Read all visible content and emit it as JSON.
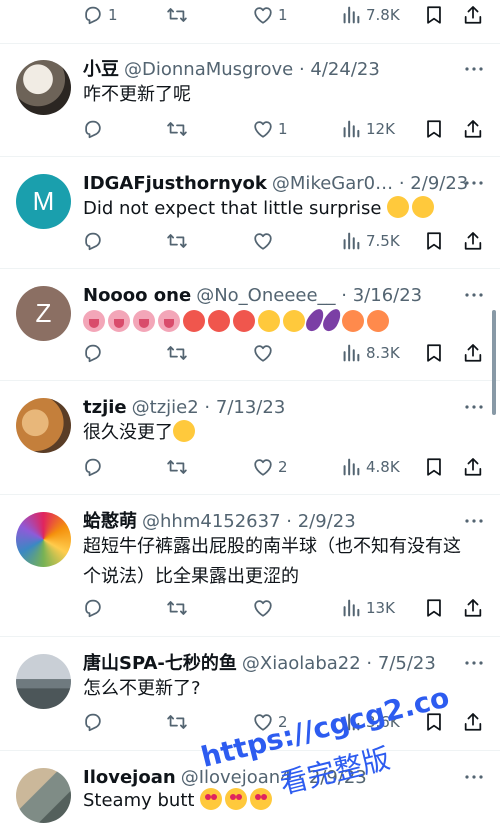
{
  "colors": {
    "text": "#0f1419",
    "muted": "#536471",
    "separator": "#eff3f4",
    "watermark": "#2d5cf0"
  },
  "top_actions": {
    "reply": "1",
    "retweet": "",
    "like": "1",
    "views": "7.8K"
  },
  "tweets": [
    {
      "name": "小豆",
      "handle": "@DionnaMusgrove",
      "date": "4/24/23",
      "text": "咋不更新了呢",
      "reply": "",
      "like": "1",
      "views": "12K"
    },
    {
      "name": "IDGAFjusthornyok",
      "handle": "@MikeGar0…",
      "date": "2/9/23",
      "text": "Did not expect that little surprise",
      "reply": "",
      "like": "",
      "views": "7.5K",
      "avatar_letter": "M"
    },
    {
      "name": "Noooo one",
      "handle": "@No_Oneeee__",
      "date": "3/16/23",
      "text": "",
      "reply": "",
      "like": "",
      "views": "8.3K",
      "avatar_letter": "Z"
    },
    {
      "name": "tzjie",
      "handle": "@tzjie2",
      "date": "7/13/23",
      "text": "很久没更了",
      "reply": "",
      "like": "2",
      "views": "4.8K"
    },
    {
      "name": "蛤憨萌",
      "handle": "@hhm4152637",
      "date": "2/9/23",
      "text": "超短牛仔裤露出屁股的南半球（也不知有没有这个说法）比全果露出更涩的",
      "reply": "",
      "like": "",
      "views": "13K"
    },
    {
      "name": "唐山SPA-七秒的鱼",
      "handle": "@Xiaolaba22",
      "date": "7/5/23",
      "text": "怎么不更新了?",
      "reply": "",
      "like": "2",
      "views": "3.6K"
    },
    {
      "name": "Ilovejoan",
      "handle": "@Ilovejoan4",
      "date": "2/9/23",
      "text": "Steamy butt"
    }
  ],
  "watermark": {
    "url": "https://cgcg2.co",
    "sub": "看完整版"
  },
  "icons": [
    "reply-icon",
    "retweet-icon",
    "like-icon",
    "views-icon",
    "bookmark-icon",
    "share-icon",
    "more-icon"
  ]
}
